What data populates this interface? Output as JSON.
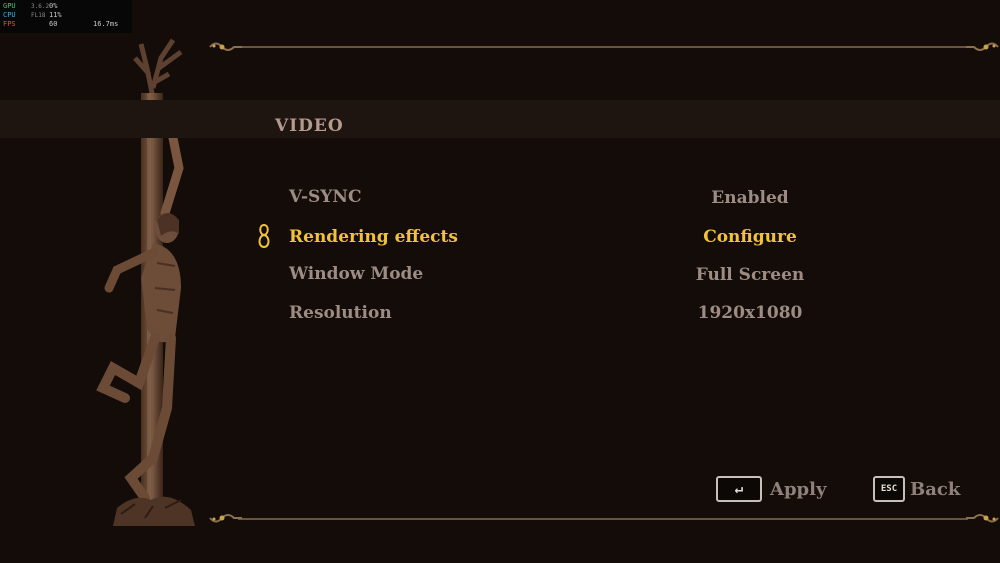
{
  "perf": {
    "gpu": {
      "label": "GPU",
      "ver": "3.6.2",
      "value": "0%"
    },
    "cpu": {
      "label": "CPU",
      "ver": "FL18",
      "value": "11%"
    },
    "fps": {
      "label": "FPS",
      "value": "60",
      "frametime": "16.7ms"
    }
  },
  "menu": {
    "title": "VIDEO",
    "options": [
      {
        "label": "V-SYNC",
        "value": "Enabled",
        "selected": false
      },
      {
        "label": "Rendering effects",
        "value": "Configure",
        "selected": true
      },
      {
        "label": "Window Mode",
        "value": "Full Screen",
        "selected": false
      },
      {
        "label": "Resolution",
        "value": "1920x1080",
        "selected": false
      }
    ]
  },
  "hints": {
    "apply": {
      "key": "↵",
      "label": "Apply"
    },
    "back": {
      "key": "ESC",
      "label": "Back"
    }
  },
  "colors": {
    "selected": "#f1c23a",
    "normal": "#9d8c84",
    "frame": "#6b5340",
    "background": "#140c08"
  }
}
